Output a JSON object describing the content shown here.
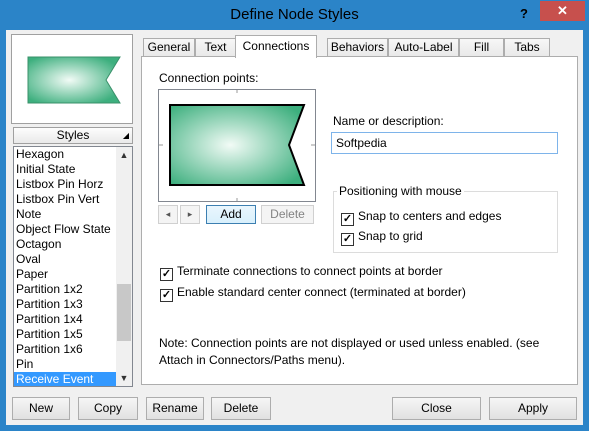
{
  "window": {
    "title": "Define Node Styles",
    "help_label": "?",
    "close_label": "✕"
  },
  "styles_panel": {
    "header": "Styles",
    "items": [
      "Hexagon",
      "Initial State",
      "Listbox Pin Horz",
      "Listbox Pin Vert",
      "Note",
      "Object Flow State",
      "Octagon",
      "Oval",
      "Paper",
      "Partition 1x2",
      "Partition 1x3",
      "Partition 1x4",
      "Partition 1x5",
      "Partition 1x6",
      "Pin",
      "Receive Event"
    ],
    "selected": "Receive Event"
  },
  "tabs": [
    "General",
    "Text",
    "Connections",
    "Behaviors",
    "Auto-Label",
    "Fill",
    "Tabs"
  ],
  "active_tab": "Connections",
  "connections": {
    "connection_points_label": "Connection points:",
    "add_label": "Add",
    "delete_label": "Delete",
    "prev_icon": "◂",
    "next_icon": "▸",
    "name_label": "Name or description:",
    "name_value": "Softpedia",
    "positioning_legend": "Positioning with mouse",
    "snap_centers_label": "Snap to centers and edges",
    "snap_grid_label": "Snap to grid",
    "terminate_label": "Terminate connections to connect points at border",
    "enable_center_label": "Enable standard center connect (terminated at border)",
    "note": "Note: Connection points are not displayed or used unless enabled.  (see Attach in Connectors/Paths menu).",
    "check_mark": "✓"
  },
  "buttons": {
    "new": "New",
    "copy": "Copy",
    "rename": "Rename",
    "delete": "Delete",
    "close": "Close",
    "apply": "Apply"
  },
  "colors": {
    "titlebar": "#2b84c8",
    "close": "#c7504d",
    "selection": "#3399ff",
    "shape_fill": "#5ec49a"
  }
}
